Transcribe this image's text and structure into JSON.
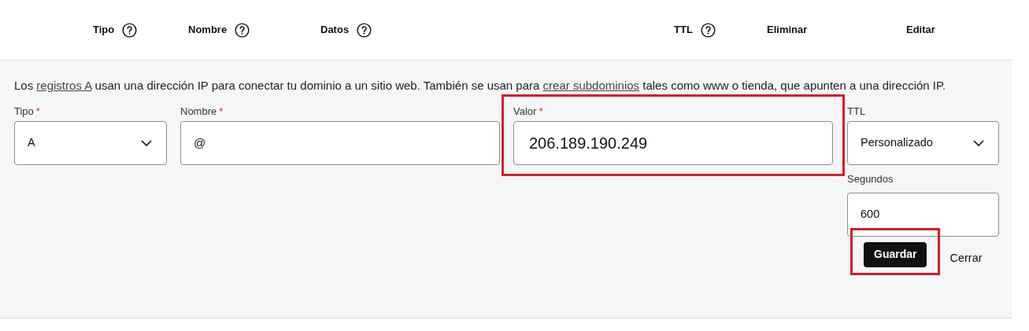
{
  "header": {
    "columns": [
      {
        "label": "Tipo",
        "help": true
      },
      {
        "label": "Nombre",
        "help": true
      },
      {
        "label": "Datos",
        "help": true
      },
      {
        "label": "TTL",
        "help": true
      },
      {
        "label": "Eliminar",
        "help": false
      },
      {
        "label": "Editar",
        "help": false
      }
    ]
  },
  "form": {
    "description": [
      {
        "text": "Los ",
        "link": false
      },
      {
        "text": "registros A",
        "link": true
      },
      {
        "text": " usan una dirección IP para conectar tu dominio a un sitio web. También se usan para ",
        "link": false
      },
      {
        "text": "crear subdominios",
        "link": true
      },
      {
        "text": " tales como www o tienda, que apunten a una dirección IP.",
        "link": false
      }
    ],
    "fields": [
      {
        "kind": "select",
        "label": "Tipo",
        "required_mark": "*",
        "value": "A",
        "highlighted": false
      },
      {
        "kind": "input",
        "label": "Nombre",
        "required_mark": "*",
        "value": "@",
        "highlighted": false
      },
      {
        "kind": "value-input",
        "label": "Valor",
        "required_mark": "*",
        "value": "206.189.190.249",
        "highlighted": true
      },
      {
        "kind": "select",
        "label": "TTL",
        "value": "Personalizado",
        "highlighted": false,
        "sub": {
          "label": "Segundos",
          "value": "600"
        }
      }
    ],
    "actions": [
      {
        "kind": "primary",
        "label": "Guardar",
        "highlighted": true
      },
      {
        "kind": "text",
        "label": "Cerrar",
        "highlighted": false
      }
    ]
  }
}
